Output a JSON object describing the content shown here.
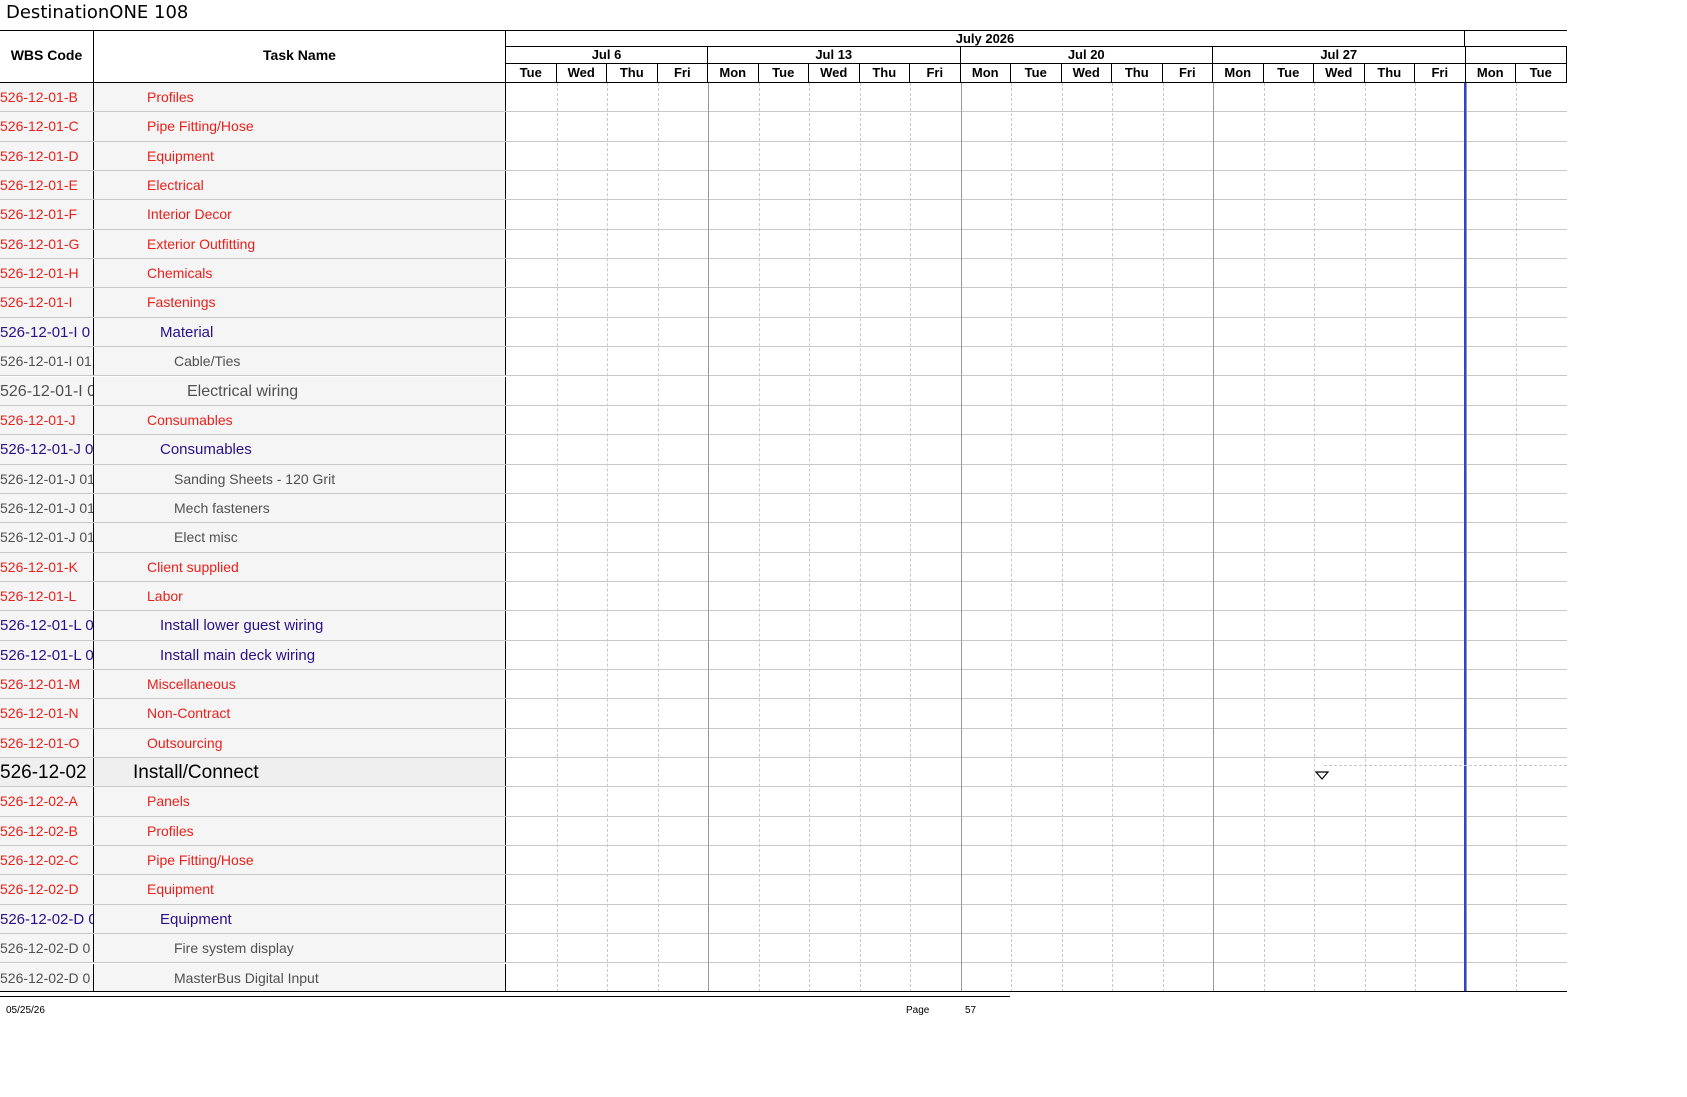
{
  "document": {
    "title": "DestinationONE 108"
  },
  "columns": {
    "wbs_header": "WBS Code",
    "task_header": "Task Name"
  },
  "timeline": {
    "month": "July 2026",
    "weeks": [
      "Jul 6",
      "Jul 13",
      "Jul 20",
      "Jul 27"
    ],
    "days": [
      "Tue",
      "Wed",
      "Thu",
      "Fri",
      "Mon",
      "Tue",
      "Wed",
      "Thu",
      "Fri",
      "Mon",
      "Tue",
      "Wed",
      "Thu",
      "Fri",
      "Mon",
      "Tue",
      "Wed",
      "Thu",
      "Fri",
      "Mon",
      "Tue"
    ]
  },
  "rows": [
    {
      "wbs": "526-12-01-B",
      "task": "Profiles",
      "level": "red"
    },
    {
      "wbs": "526-12-01-C",
      "task": "Pipe Fitting/Hose",
      "level": "red"
    },
    {
      "wbs": "526-12-01-D",
      "task": "Equipment",
      "level": "red"
    },
    {
      "wbs": "526-12-01-E",
      "task": "Electrical",
      "level": "red"
    },
    {
      "wbs": "526-12-01-F",
      "task": "Interior Decor",
      "level": "red"
    },
    {
      "wbs": "526-12-01-G",
      "task": "Exterior Outfitting",
      "level": "red"
    },
    {
      "wbs": "526-12-01-H",
      "task": "Chemicals",
      "level": "red"
    },
    {
      "wbs": "526-12-01-I",
      "task": "Fastenings",
      "level": "red"
    },
    {
      "wbs": "526-12-01-I 0",
      "task": "Material",
      "level": "blue"
    },
    {
      "wbs": "526-12-01-I 01",
      "task": "Cable/Ties",
      "level": "gray"
    },
    {
      "wbs": "526-12-01-I 0",
      "task": "Electrical wiring",
      "level": "gray2"
    },
    {
      "wbs": "526-12-01-J",
      "task": "Consumables",
      "level": "red"
    },
    {
      "wbs": "526-12-01-J 0",
      "task": "Consumables",
      "level": "blue"
    },
    {
      "wbs": "526-12-01-J 01",
      "task": "Sanding Sheets - 120 Grit",
      "level": "gray"
    },
    {
      "wbs": "526-12-01-J 01",
      "task": "Mech fasteners",
      "level": "gray"
    },
    {
      "wbs": "526-12-01-J 01",
      "task": "Elect misc",
      "level": "gray"
    },
    {
      "wbs": "526-12-01-K",
      "task": "Client supplied",
      "level": "red"
    },
    {
      "wbs": "526-12-01-L",
      "task": "Labor",
      "level": "red"
    },
    {
      "wbs": "526-12-01-L 0",
      "task": "Install lower guest wiring",
      "level": "blue"
    },
    {
      "wbs": "526-12-01-L 0",
      "task": "Install main deck wiring",
      "level": "blue"
    },
    {
      "wbs": "526-12-01-M",
      "task": "Miscellaneous",
      "level": "red"
    },
    {
      "wbs": "526-12-01-N",
      "task": "Non-Contract",
      "level": "red"
    },
    {
      "wbs": "526-12-01-O",
      "task": "Outsourcing",
      "level": "red"
    },
    {
      "wbs": "526-12-02",
      "task": "Install/Connect",
      "level": "sum"
    },
    {
      "wbs": "526-12-02-A",
      "task": "Panels",
      "level": "red"
    },
    {
      "wbs": "526-12-02-B",
      "task": "Profiles",
      "level": "red"
    },
    {
      "wbs": "526-12-02-C",
      "task": "Pipe Fitting/Hose",
      "level": "red"
    },
    {
      "wbs": "526-12-02-D",
      "task": "Equipment",
      "level": "red"
    },
    {
      "wbs": "526-12-02-D 0",
      "task": "Equipment",
      "level": "blue"
    },
    {
      "wbs": "526-12-02-D 0",
      "task": "Fire system display",
      "level": "gray"
    },
    {
      "wbs": "526-12-02-D 0",
      "task": "MasterBus Digital Input",
      "level": "gray"
    }
  ],
  "colors": {
    "red": "#e8201b",
    "blue": "#2a0f8a",
    "gray": "#505050",
    "today_line": "#3340d0"
  },
  "footer": {
    "date": "05/25/26",
    "page_label": "Page",
    "page_number": "57"
  }
}
